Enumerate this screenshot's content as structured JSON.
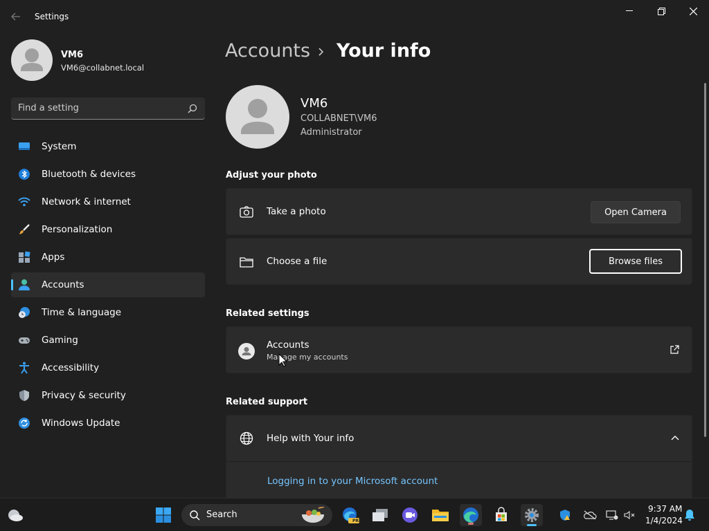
{
  "window": {
    "title": "Settings"
  },
  "profile": {
    "name": "VM6",
    "email": "VM6@collabnet.local"
  },
  "search": {
    "placeholder": "Find a setting"
  },
  "nav": {
    "items": [
      {
        "label": "System",
        "icon": "monitor-icon"
      },
      {
        "label": "Bluetooth & devices",
        "icon": "bluetooth-icon"
      },
      {
        "label": "Network & internet",
        "icon": "wifi-icon"
      },
      {
        "label": "Personalization",
        "icon": "brush-icon"
      },
      {
        "label": "Apps",
        "icon": "apps-icon"
      },
      {
        "label": "Accounts",
        "icon": "person-icon",
        "active": true
      },
      {
        "label": "Time & language",
        "icon": "globe-clock-icon"
      },
      {
        "label": "Gaming",
        "icon": "gamepad-icon"
      },
      {
        "label": "Accessibility",
        "icon": "accessibility-icon"
      },
      {
        "label": "Privacy & security",
        "icon": "shield-icon"
      },
      {
        "label": "Windows Update",
        "icon": "update-icon"
      }
    ]
  },
  "breadcrumb": {
    "parent": "Accounts",
    "current": "Your info"
  },
  "user": {
    "name": "VM6",
    "domain": "COLLABNET\\VM6",
    "role": "Administrator"
  },
  "adjust_photo": {
    "title": "Adjust your photo",
    "take_photo": {
      "label": "Take a photo",
      "button": "Open Camera"
    },
    "choose_file": {
      "label": "Choose a file",
      "button": "Browse files"
    }
  },
  "related_settings": {
    "title": "Related settings",
    "accounts": {
      "label": "Accounts",
      "sub": "Manage my accounts"
    }
  },
  "related_support": {
    "title": "Related support",
    "help": {
      "label": "Help with Your info"
    },
    "link": "Logging in to your Microsoft account"
  },
  "taskbar": {
    "search_label": "Search",
    "time": "9:37 AM",
    "date": "1/4/2024",
    "edge_badge": "PRE"
  },
  "colors": {
    "accent": "#4cc2ff",
    "link": "#76c5ff",
    "background": "#202020",
    "card": "#2b2b2b"
  }
}
